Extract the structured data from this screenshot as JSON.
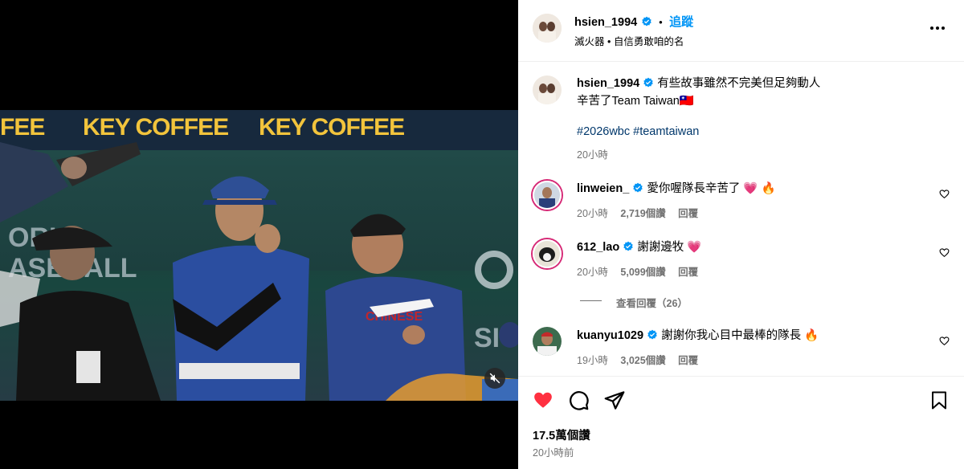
{
  "header": {
    "username": "hsien_1994",
    "dot": "•",
    "follow_label": "追蹤",
    "subtitle": "滅火器 • 自信勇敢咱的名"
  },
  "caption": {
    "username": "hsien_1994",
    "line1": "有些故事雖然不完美但足夠動人",
    "line2": "辛苦了Team Taiwan🇹🇼",
    "hashtags": "#2026wbc #teamtaiwan",
    "time": "20小時"
  },
  "comments": [
    {
      "username": "linweien_",
      "text": "愛你喔隊長辛苦了 💗 🔥",
      "time": "20小時",
      "likes": "2,719個讚",
      "reply": "回覆"
    },
    {
      "username": "612_lao",
      "text": "謝謝邊牧 💗",
      "time": "20小時",
      "likes": "5,099個讚",
      "reply": "回覆"
    },
    {
      "username": "kuanyu1029",
      "text": "謝謝你我心目中最棒的隊長 🔥",
      "time": "19小時",
      "likes": "3,025個讚",
      "reply": "回覆"
    }
  ],
  "view_replies": "查看回覆（26）",
  "footer": {
    "likes": "17.5萬個讚",
    "time": "20小時前"
  },
  "video": {
    "banner": [
      "FEE",
      "KEY COFFEE",
      "KEY COFFEE"
    ],
    "wall_text": [
      "ORL",
      "ASEBALL",
      "SIC"
    ]
  },
  "colors": {
    "verified": "#0095f6",
    "liked_heart": "#ff3040",
    "follow": "#0095f6"
  },
  "icons": [
    "more-options-icon",
    "verified-icon",
    "heart-icon",
    "comment-icon",
    "share-icon",
    "bookmark-icon",
    "mute-icon"
  ]
}
